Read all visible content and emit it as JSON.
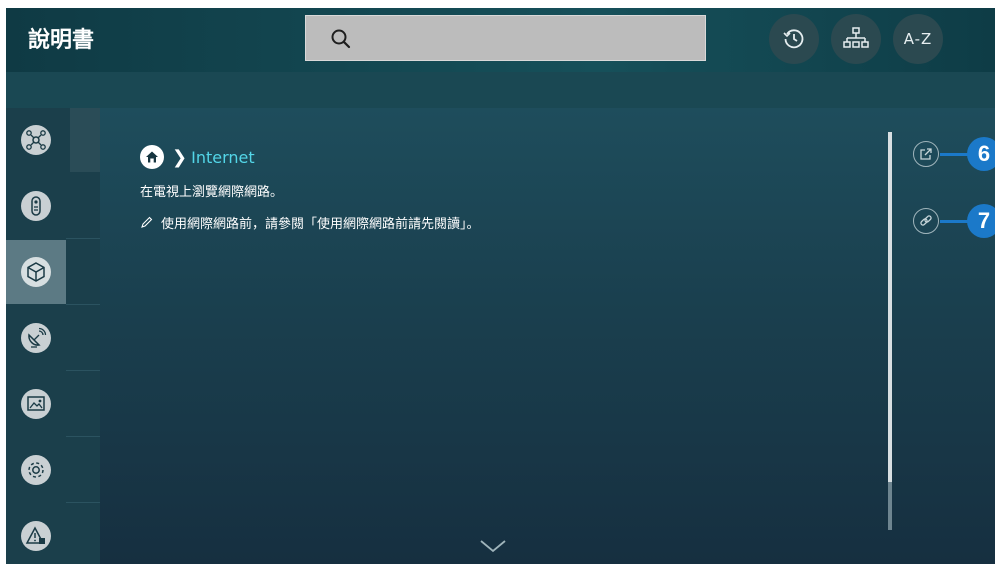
{
  "header": {
    "title": "說明書",
    "search_icon": "search-icon",
    "buttons": [
      {
        "name": "history",
        "icon": "history-icon"
      },
      {
        "name": "sitemap",
        "icon": "sitemap-icon"
      },
      {
        "name": "index",
        "label": "A-Z"
      }
    ]
  },
  "sidebar": {
    "items": [
      {
        "icon": "network-nodes-icon"
      },
      {
        "icon": "remote-control-icon"
      },
      {
        "icon": "box-3d-icon",
        "active": true
      },
      {
        "icon": "satellite-dish-icon"
      },
      {
        "icon": "picture-icon"
      },
      {
        "icon": "gear-icon"
      },
      {
        "icon": "warning-icon"
      }
    ]
  },
  "content": {
    "breadcrumb": {
      "home_icon": "home-icon",
      "current": "Internet"
    },
    "description": "在電視上瀏覽網際網路。",
    "note": "使用網際網路前，請參閱「使用網際網路前請先閱讀」。",
    "actions": [
      {
        "icon": "open-external-icon",
        "callout": "6"
      },
      {
        "icon": "link-icon",
        "callout": "7"
      }
    ]
  },
  "colors": {
    "accent": "#53d6e8",
    "callout": "#1b79c9"
  }
}
